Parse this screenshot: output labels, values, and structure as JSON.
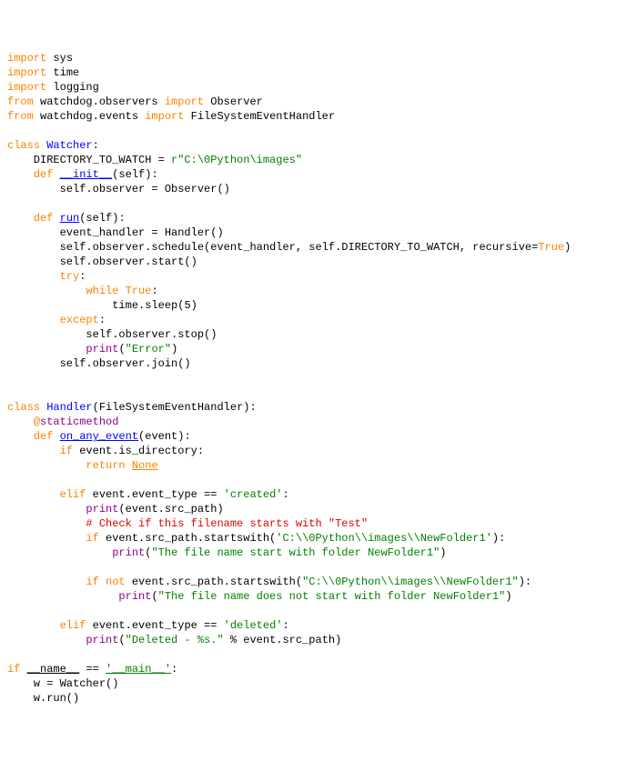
{
  "lines": [
    {
      "segments": [
        {
          "t": "import",
          "c": "kw"
        },
        {
          "t": " sys"
        }
      ]
    },
    {
      "segments": [
        {
          "t": "import",
          "c": "kw"
        },
        {
          "t": " time"
        }
      ]
    },
    {
      "segments": [
        {
          "t": "import",
          "c": "kw"
        },
        {
          "t": " logging"
        }
      ]
    },
    {
      "segments": [
        {
          "t": "from",
          "c": "kw"
        },
        {
          "t": " watchdog.observers "
        },
        {
          "t": "import",
          "c": "kw"
        },
        {
          "t": " Observer"
        }
      ]
    },
    {
      "segments": [
        {
          "t": "from",
          "c": "kw"
        },
        {
          "t": " watchdog.events "
        },
        {
          "t": "import",
          "c": "kw"
        },
        {
          "t": " FileSystemEventHandler"
        }
      ]
    },
    {
      "segments": [
        {
          "t": ""
        }
      ]
    },
    {
      "segments": [
        {
          "t": "class",
          "c": "kw"
        },
        {
          "t": " "
        },
        {
          "t": "Watcher",
          "c": "name-def"
        },
        {
          "t": ":"
        }
      ]
    },
    {
      "segments": [
        {
          "t": "    DIRECTORY_TO_WATCH = "
        },
        {
          "t": "r\"C:\\0Python\\images\"",
          "c": "str"
        }
      ]
    },
    {
      "segments": [
        {
          "t": "    "
        },
        {
          "t": "def",
          "c": "kw"
        },
        {
          "t": " "
        },
        {
          "t": "__init__",
          "c": "name-def underline"
        },
        {
          "t": "(self):"
        }
      ]
    },
    {
      "segments": [
        {
          "t": "        self.observer = Observer()"
        }
      ]
    },
    {
      "segments": [
        {
          "t": ""
        }
      ]
    },
    {
      "segments": [
        {
          "t": "    "
        },
        {
          "t": "def",
          "c": "kw"
        },
        {
          "t": " "
        },
        {
          "t": "run",
          "c": "name-def underline"
        },
        {
          "t": "(self):"
        }
      ]
    },
    {
      "segments": [
        {
          "t": "        event_handler = Handler()"
        }
      ]
    },
    {
      "segments": [
        {
          "t": "        self.observer.schedule(event_handler, self.DIRECTORY_TO_WATCH, recursive="
        },
        {
          "t": "True",
          "c": "kw"
        },
        {
          "t": ")"
        }
      ]
    },
    {
      "segments": [
        {
          "t": "        self.observer.start()"
        }
      ]
    },
    {
      "segments": [
        {
          "t": "        "
        },
        {
          "t": "try",
          "c": "kw"
        },
        {
          "t": ":"
        }
      ]
    },
    {
      "segments": [
        {
          "t": "            "
        },
        {
          "t": "while",
          "c": "kw"
        },
        {
          "t": " "
        },
        {
          "t": "True",
          "c": "kw"
        },
        {
          "t": ":"
        }
      ]
    },
    {
      "segments": [
        {
          "t": "                time.sleep("
        },
        {
          "t": "5"
        },
        {
          "t": ")"
        }
      ]
    },
    {
      "segments": [
        {
          "t": "        "
        },
        {
          "t": "except",
          "c": "kw"
        },
        {
          "t": ":"
        }
      ]
    },
    {
      "segments": [
        {
          "t": "            self.observer.stop()"
        }
      ]
    },
    {
      "segments": [
        {
          "t": "            "
        },
        {
          "t": "print",
          "c": "builtin"
        },
        {
          "t": "("
        },
        {
          "t": "\"Error\"",
          "c": "str"
        },
        {
          "t": ")"
        }
      ]
    },
    {
      "segments": [
        {
          "t": "        self.observer.join()"
        }
      ]
    },
    {
      "segments": [
        {
          "t": ""
        }
      ]
    },
    {
      "segments": [
        {
          "t": ""
        }
      ]
    },
    {
      "segments": [
        {
          "t": "class",
          "c": "kw"
        },
        {
          "t": " "
        },
        {
          "t": "Handler",
          "c": "name-def"
        },
        {
          "t": "(FileSystemEventHandler):"
        }
      ]
    },
    {
      "segments": [
        {
          "t": "    "
        },
        {
          "t": "@",
          "c": "kw"
        },
        {
          "t": "staticmethod",
          "c": "builtin"
        }
      ]
    },
    {
      "segments": [
        {
          "t": "    "
        },
        {
          "t": "def",
          "c": "kw"
        },
        {
          "t": " "
        },
        {
          "t": "on_any_event",
          "c": "name-def underline"
        },
        {
          "t": "(event):"
        }
      ]
    },
    {
      "segments": [
        {
          "t": "        "
        },
        {
          "t": "if",
          "c": "kw"
        },
        {
          "t": " event.is_directory:"
        }
      ]
    },
    {
      "segments": [
        {
          "t": "            "
        },
        {
          "t": "return",
          "c": "kw"
        },
        {
          "t": " "
        },
        {
          "t": "None",
          "c": "kw underline"
        }
      ]
    },
    {
      "segments": [
        {
          "t": ""
        }
      ]
    },
    {
      "segments": [
        {
          "t": "        "
        },
        {
          "t": "elif",
          "c": "kw"
        },
        {
          "t": " event.event_type == "
        },
        {
          "t": "'created'",
          "c": "str"
        },
        {
          "t": ":"
        }
      ]
    },
    {
      "segments": [
        {
          "t": "            "
        },
        {
          "t": "print",
          "c": "builtin"
        },
        {
          "t": "(event.src_path)"
        }
      ]
    },
    {
      "segments": [
        {
          "t": "            "
        },
        {
          "t": "# Check if this filename starts with \"Test\"",
          "c": "comment"
        }
      ]
    },
    {
      "segments": [
        {
          "t": "            "
        },
        {
          "t": "if",
          "c": "kw"
        },
        {
          "t": " event.src_path.startswith("
        },
        {
          "t": "'C:\\\\0Python\\\\images\\\\NewFolder1'",
          "c": "str"
        },
        {
          "t": "):"
        }
      ]
    },
    {
      "segments": [
        {
          "t": "                "
        },
        {
          "t": "print",
          "c": "builtin"
        },
        {
          "t": "("
        },
        {
          "t": "\"The file name start with folder NewFolder1\"",
          "c": "str"
        },
        {
          "t": ")"
        }
      ]
    },
    {
      "segments": [
        {
          "t": ""
        }
      ]
    },
    {
      "segments": [
        {
          "t": "            "
        },
        {
          "t": "if",
          "c": "kw"
        },
        {
          "t": " "
        },
        {
          "t": "not",
          "c": "kw"
        },
        {
          "t": " event.src_path.startswith("
        },
        {
          "t": "\"C:\\\\0Python\\\\images\\\\NewFolder1\"",
          "c": "str"
        },
        {
          "t": "):"
        }
      ]
    },
    {
      "segments": [
        {
          "t": "                 "
        },
        {
          "t": "print",
          "c": "builtin"
        },
        {
          "t": "("
        },
        {
          "t": "\"The file name does not start with folder NewFolder1\"",
          "c": "str"
        },
        {
          "t": ")"
        }
      ]
    },
    {
      "segments": [
        {
          "t": ""
        }
      ]
    },
    {
      "segments": [
        {
          "t": "        "
        },
        {
          "t": "elif",
          "c": "kw"
        },
        {
          "t": " event.event_type == "
        },
        {
          "t": "'deleted'",
          "c": "str"
        },
        {
          "t": ":"
        }
      ]
    },
    {
      "segments": [
        {
          "t": "            "
        },
        {
          "t": "print",
          "c": "builtin"
        },
        {
          "t": "("
        },
        {
          "t": "\"Deleted - %s.\"",
          "c": "str"
        },
        {
          "t": " % event.src_path)"
        }
      ]
    },
    {
      "segments": [
        {
          "t": ""
        }
      ]
    },
    {
      "segments": [
        {
          "t": "if",
          "c": "kw"
        },
        {
          "t": " "
        },
        {
          "t": "__name__",
          "c": "underline"
        },
        {
          "t": " == "
        },
        {
          "t": "'__main__'",
          "c": "str underline"
        },
        {
          "t": ":"
        }
      ]
    },
    {
      "segments": [
        {
          "t": "    w = Watcher()"
        }
      ]
    },
    {
      "segments": [
        {
          "t": "    w.run()"
        }
      ]
    }
  ]
}
